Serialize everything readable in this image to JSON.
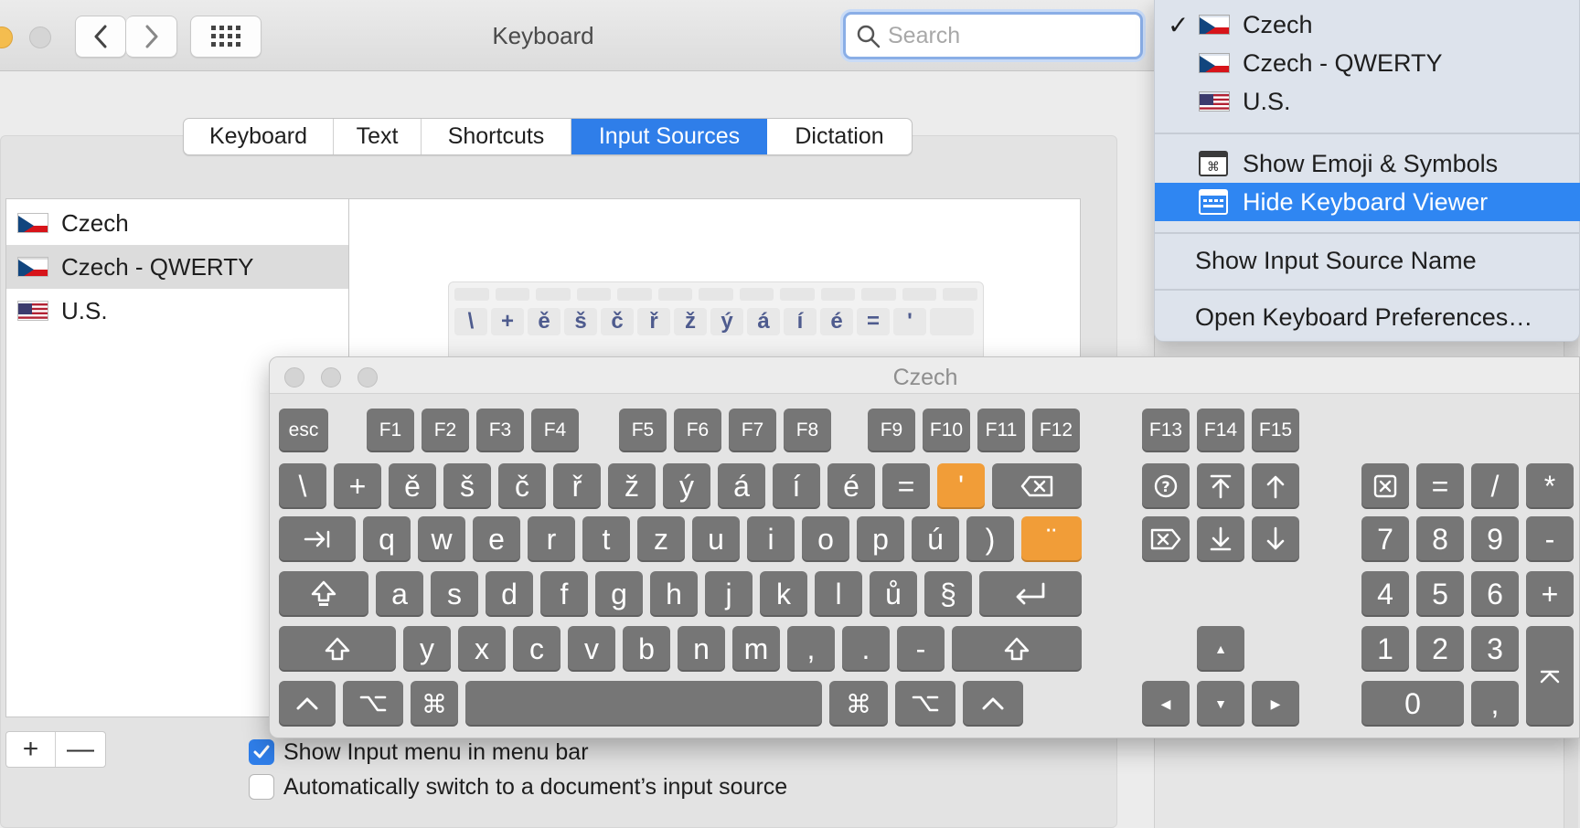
{
  "window": {
    "title": "Keyboard"
  },
  "search": {
    "placeholder": "Search"
  },
  "tabs": [
    "Keyboard",
    "Text",
    "Shortcuts",
    "Input Sources",
    "Dictation"
  ],
  "active_tab": "Input Sources",
  "sources": [
    {
      "label": "Czech",
      "flag": "czech-flag"
    },
    {
      "label": "Czech - QWERTY",
      "flag": "czech-flag",
      "selected": true
    },
    {
      "label": "U.S.",
      "flag": "us-flag"
    }
  ],
  "mini_keyboard_row": [
    "\\",
    "+",
    "ě",
    "š",
    "č",
    "ř",
    "ž",
    "ý",
    "á",
    "í",
    "é",
    "=",
    "'"
  ],
  "list_buttons": {
    "add": "+",
    "remove": "—"
  },
  "checkboxes": [
    {
      "label": "Show Input menu in menu bar",
      "checked": true
    },
    {
      "label": "Automatically switch to a document’s input source",
      "checked": false
    }
  ],
  "input_menu": {
    "sources": [
      "Czech",
      "Czech - QWERTY",
      "U.S."
    ],
    "checked_source": "Czech",
    "actions": [
      "Show Emoji & Symbols",
      "Hide Keyboard Viewer"
    ],
    "highlighted": "Hide Keyboard Viewer",
    "extra": [
      "Show Input Source Name",
      "Open Keyboard Preferences…"
    ]
  },
  "keyboard_viewer": {
    "title": "Czech",
    "esc": "esc",
    "f_keys": [
      "F1",
      "F2",
      "F3",
      "F4",
      "F5",
      "F6",
      "F7",
      "F8",
      "F9",
      "F10",
      "F11",
      "F12",
      "F13",
      "F14",
      "F15"
    ],
    "row_numbers": [
      "\\",
      "+",
      "ě",
      "š",
      "č",
      "ř",
      "ž",
      "ý",
      "á",
      "í",
      "é",
      "=",
      "'"
    ],
    "row_top": [
      "q",
      "w",
      "e",
      "r",
      "t",
      "z",
      "u",
      "i",
      "o",
      "p",
      "ú",
      ")",
      "¨"
    ],
    "row_home": [
      "a",
      "s",
      "d",
      "f",
      "g",
      "h",
      "j",
      "k",
      "l",
      "ů",
      "§"
    ],
    "row_bottom": [
      "y",
      "x",
      "c",
      "v",
      "b",
      "n",
      "m",
      ",",
      ".",
      "-"
    ],
    "numpad": {
      "row1": [
        "=",
        "/",
        "*"
      ],
      "row2": [
        "7",
        "8",
        "9",
        "-"
      ],
      "row3": [
        "4",
        "5",
        "6",
        "+"
      ],
      "row4": [
        "1",
        "2",
        "3"
      ],
      "row5": [
        "0",
        ","
      ]
    },
    "dead_keys": [
      "'",
      "¨"
    ],
    "colors": {
      "key": "#767676",
      "dead_key": "#f19d38"
    }
  },
  "colors": {
    "accent": "#2f7ee9",
    "menu_highlight": "#2f86f2"
  }
}
